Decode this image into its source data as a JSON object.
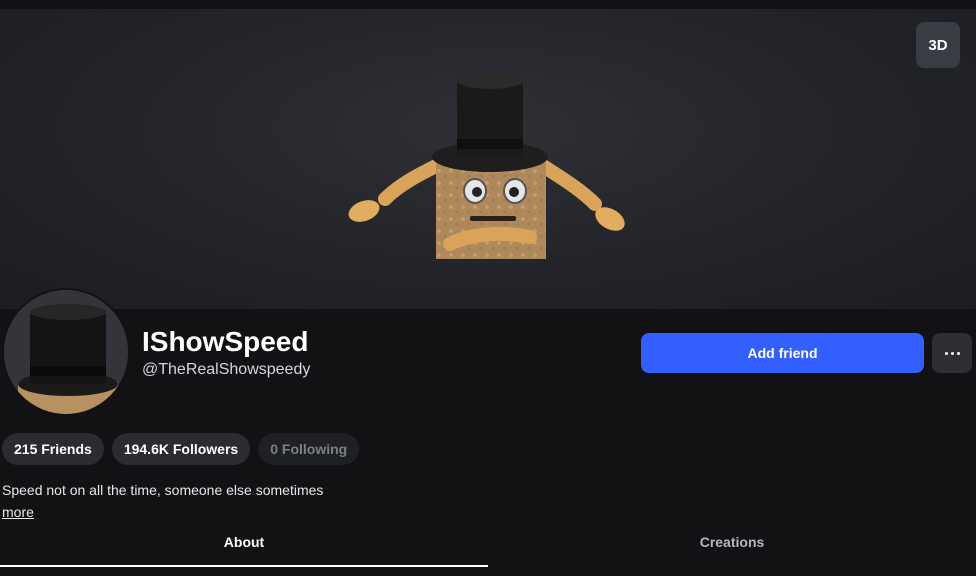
{
  "banner": {
    "view_3d_label": "3D"
  },
  "profile": {
    "display_name": "IShowSpeed",
    "username": "@TheRealShowspeedy",
    "add_friend_label": "Add friend",
    "more_options_icon": "ellipsis-icon"
  },
  "stats": {
    "friends": "215 Friends",
    "followers": "194.6K Followers",
    "following": "0 Following"
  },
  "about": {
    "bio": "Speed not on all the time, someone else sometimes",
    "more_label": "more"
  },
  "tabs": [
    {
      "label": "About",
      "active": true
    },
    {
      "label": "Creations",
      "active": false
    }
  ],
  "colors": {
    "accent": "#335fff",
    "background": "#121215"
  }
}
